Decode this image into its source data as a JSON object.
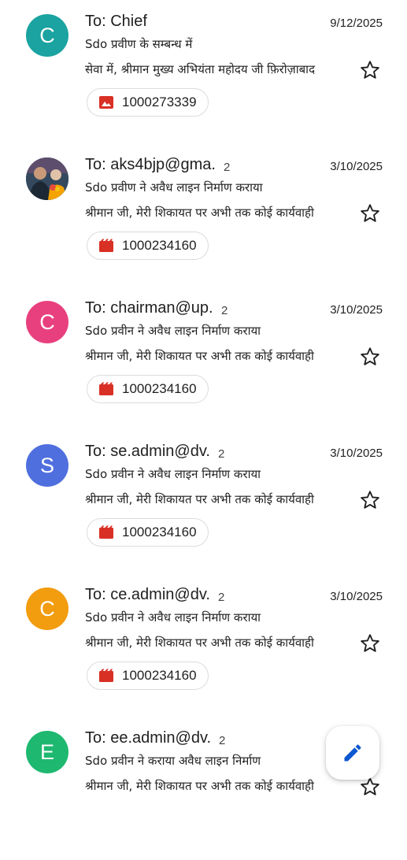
{
  "colors": {
    "attachment_red": "#d93025",
    "compose_blue": "#0b57d0"
  },
  "emails": [
    {
      "recipient": "To: Chief",
      "count": "",
      "date": "9/12/2025",
      "subject": "Sdo प्रवीण के सम्बन्ध में",
      "snippet": "सेवा में, श्रीमान मुख्य अभियंता महोदय जी फ़िरोज़ाबाद",
      "avatar": {
        "letter": "C",
        "color": "#1aa3a0"
      },
      "attachment": {
        "name": "1000273339",
        "icon": "image-icon"
      },
      "starred": false
    },
    {
      "recipient": "To: aks4bjp@gma.",
      "count": "2",
      "date": "3/10/2025",
      "subject": "Sdo प्रवीण ने अवैध लाइन निर्माण कराया",
      "snippet": "श्रीमान जी, मेरी शिकायत पर अभी तक कोई कार्यवाही",
      "avatar": {
        "letter": "",
        "color": "#2c3e50"
      },
      "attachment": {
        "name": "1000234160",
        "icon": "video-icon"
      },
      "starred": false
    },
    {
      "recipient": "To: chairman@up.",
      "count": "2",
      "date": "3/10/2025",
      "subject": "Sdo प्रवीन ने अवैध लाइन निर्माण कराया",
      "snippet": "श्रीमान जी, मेरी शिकायत पर अभी तक कोई कार्यवाही",
      "avatar": {
        "letter": "C",
        "color": "#e8407e"
      },
      "attachment": {
        "name": "1000234160",
        "icon": "video-icon"
      },
      "starred": false
    },
    {
      "recipient": "To: se.admin@dv.",
      "count": "2",
      "date": "3/10/2025",
      "subject": "Sdo प्रवीन ने अवैध लाइन निर्माण कराया",
      "snippet": "श्रीमान जी, मेरी शिकायत पर अभी तक कोई कार्यवाही",
      "avatar": {
        "letter": "S",
        "color": "#4f6fde"
      },
      "attachment": {
        "name": "1000234160",
        "icon": "video-icon"
      },
      "starred": false
    },
    {
      "recipient": "To: ce.admin@dv.",
      "count": "2",
      "date": "3/10/2025",
      "subject": "Sdo प्रवीन ने अवैध लाइन निर्माण कराया",
      "snippet": "श्रीमान जी, मेरी शिकायत पर अभी तक कोई कार्यवाही",
      "avatar": {
        "letter": "C",
        "color": "#f29c0f"
      },
      "attachment": {
        "name": "1000234160",
        "icon": "video-icon"
      },
      "starred": false
    },
    {
      "recipient": "To: ee.admin@dv.",
      "count": "2",
      "date": "",
      "subject": "Sdo प्रवीन ने कराया अवैध लाइन निर्माण",
      "snippet": "श्रीमान जी, मेरी शिकायत पर अभी तक कोई कार्यवाही",
      "avatar": {
        "letter": "E",
        "color": "#1fb870"
      },
      "attachment": null,
      "starred": false
    }
  ],
  "fab": {
    "icon": "pencil-icon"
  }
}
